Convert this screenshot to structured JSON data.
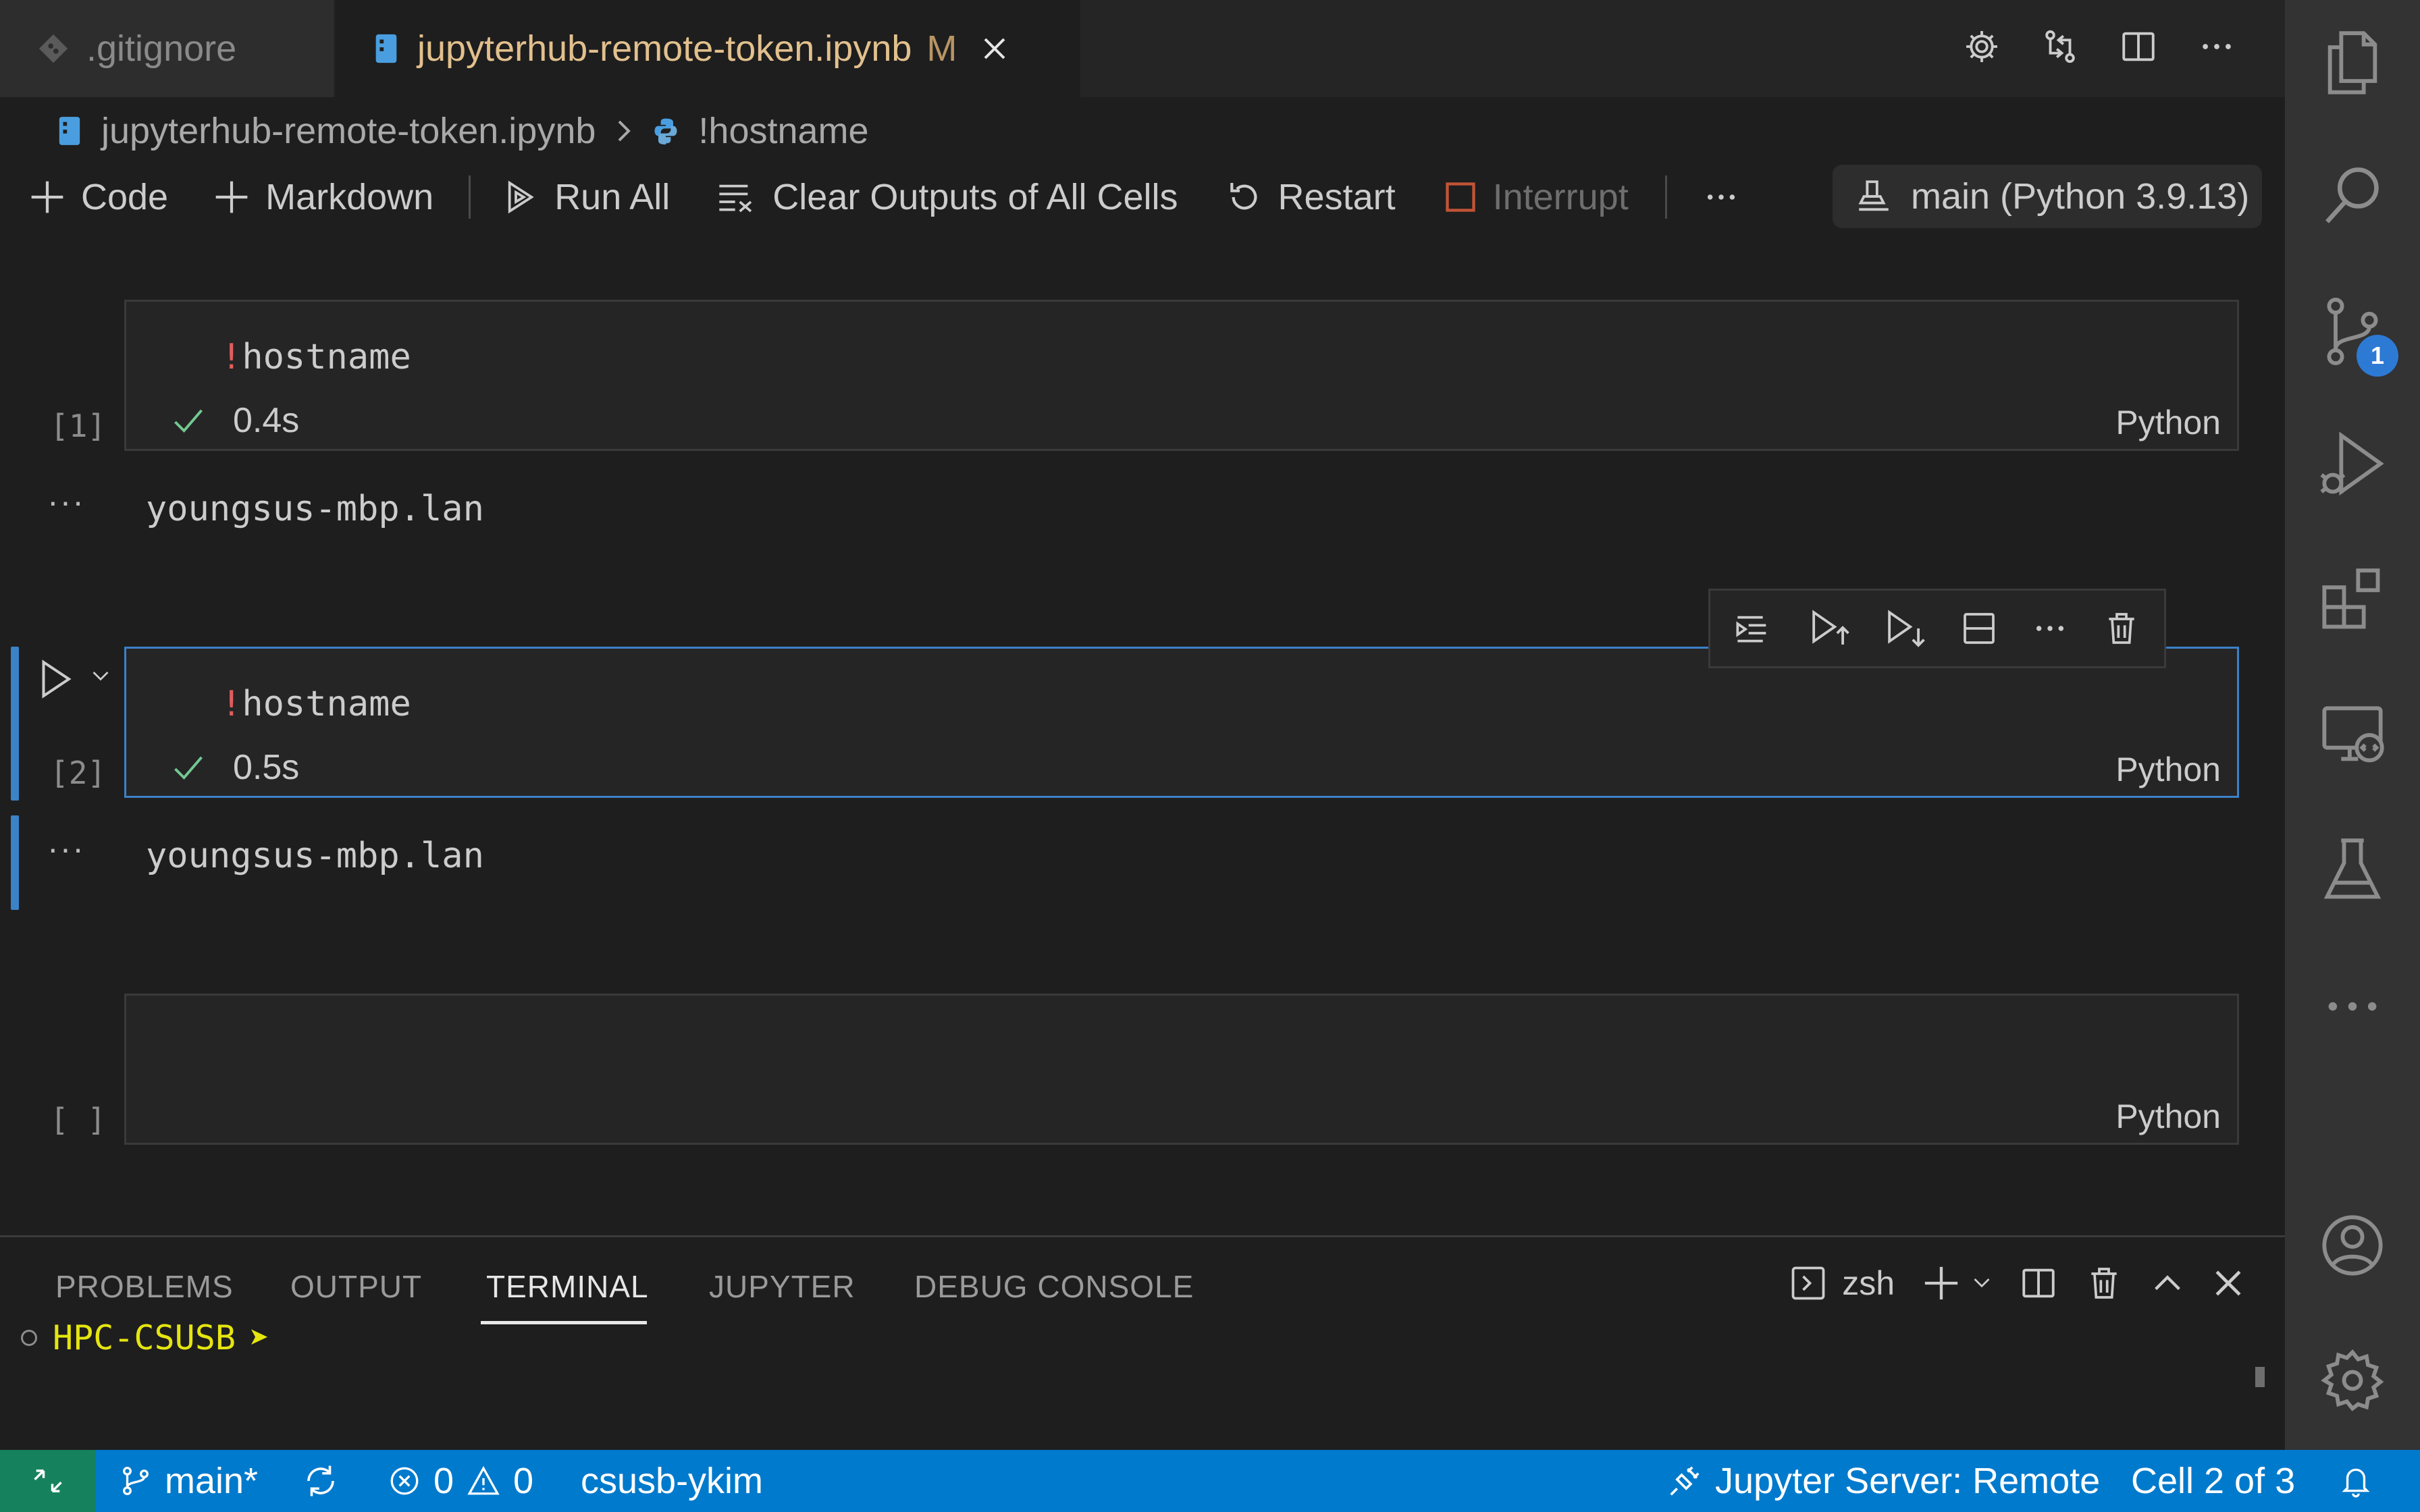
{
  "tabs": [
    {
      "label": ".gitignore"
    },
    {
      "label": "jupyterhub-remote-token.ipynb",
      "modified_badge": "M"
    }
  ],
  "breadcrumb": {
    "file": "jupyterhub-remote-token.ipynb",
    "symbol": "!hostname"
  },
  "toolbar": {
    "code": "Code",
    "markdown": "Markdown",
    "run_all": "Run All",
    "clear_outputs": "Clear Outputs of All Cells",
    "restart": "Restart",
    "interrupt": "Interrupt",
    "kernel": "main (Python 3.9.13)"
  },
  "cells": [
    {
      "exec_count": "[1]",
      "bang": "!",
      "code": "hostname",
      "duration": "0.4s",
      "language": "Python",
      "output": "youngsus-mbp.lan"
    },
    {
      "exec_count": "[2]",
      "bang": "!",
      "code": "hostname",
      "duration": "0.5s",
      "language": "Python",
      "output": "youngsus-mbp.lan"
    },
    {
      "exec_count": "[ ]",
      "code": "",
      "language": "Python"
    }
  ],
  "panel": {
    "tabs": [
      "PROBLEMS",
      "OUTPUT",
      "TERMINAL",
      "JUPYTER",
      "DEBUG CONSOLE"
    ],
    "active_tab": "TERMINAL",
    "shell": "zsh",
    "prompt": "HPC-CSUSB",
    "prompt_arrow": "➤"
  },
  "activity": {
    "source_control_badge": "1"
  },
  "statusbar": {
    "branch": "main*",
    "errors": "0",
    "warnings": "0",
    "user": "csusb-ykim",
    "jupyter_server": "Jupyter Server: Remote",
    "cell_position": "Cell 2 of 3"
  },
  "colors": {
    "accent": "#007acc",
    "remote": "#16825d",
    "focus_border": "#3b82c7",
    "modified_tab": "#e2c08d",
    "prompt": "#e5e510"
  }
}
